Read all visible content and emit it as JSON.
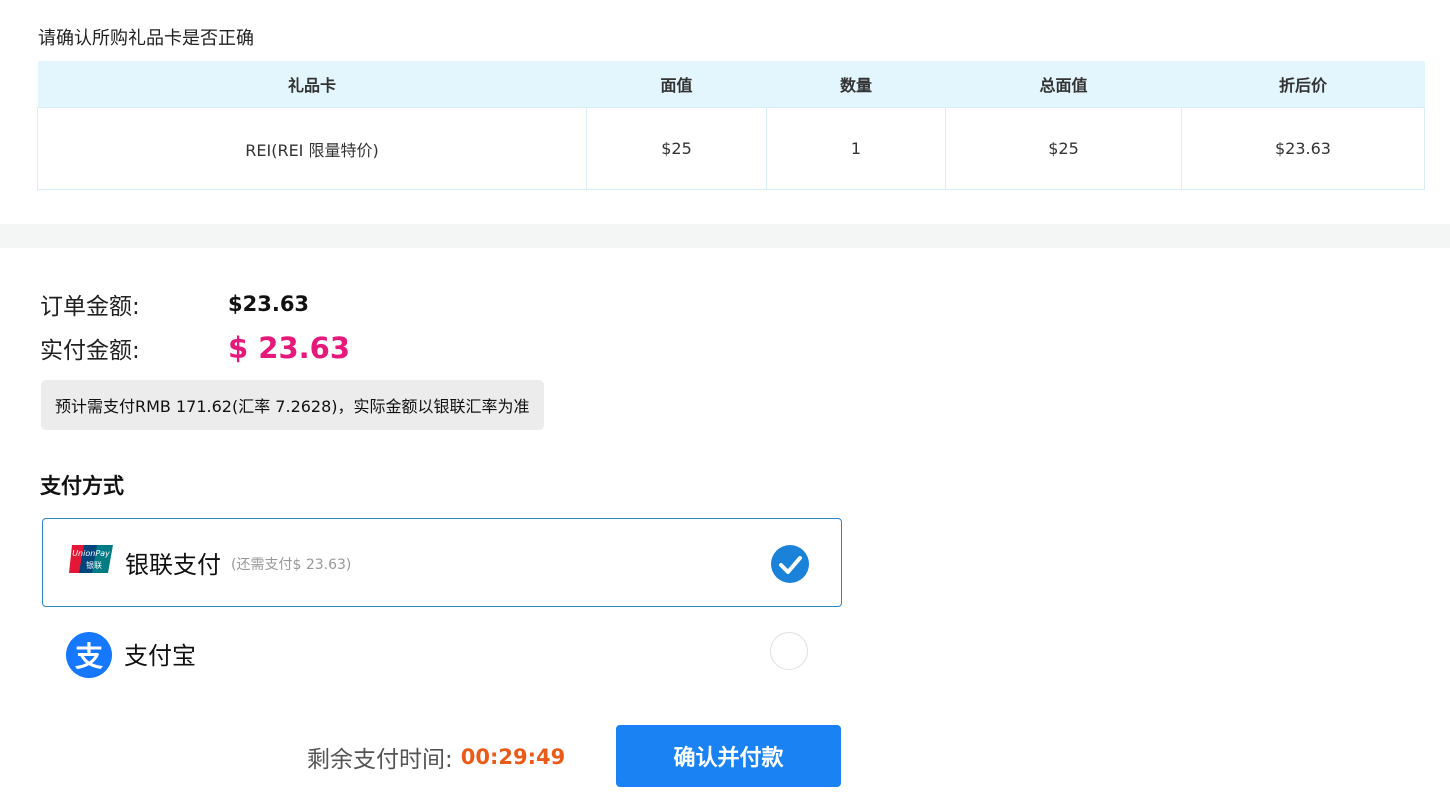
{
  "header": {
    "confirm_title": "请确认所购礼品卡是否正确"
  },
  "table": {
    "columns": [
      "礼品卡",
      "面值",
      "数量",
      "总面值",
      "折后价"
    ],
    "rows": [
      [
        "REI(REI 限量特价)",
        "$25",
        "1",
        "$25",
        "$23.63"
      ]
    ]
  },
  "amounts": {
    "order_label": "订单金额:",
    "order_value": "$23.63",
    "paid_label": "实付金额:",
    "paid_value": "$ 23.63",
    "rmb_note": "预计需支付RMB 171.62(汇率 7.2628)，实际金额以银联汇率为准"
  },
  "payment": {
    "title": "支付方式",
    "options": [
      {
        "name": "银联支付",
        "hint": "(还需支付$ 23.63)",
        "icon": "unionpay-logo-icon",
        "logo_text_top": "UnionPay",
        "logo_text_bottom": "银联",
        "selected": true
      },
      {
        "name": "支付宝",
        "icon": "alipay-logo-icon",
        "logo_glyph": "支",
        "selected": false
      }
    ]
  },
  "footer": {
    "timer_label": "剩余支付时间:",
    "timer_value": "00:29:49",
    "confirm_label": "确认并付款"
  },
  "colors": {
    "accent_blue": "#1a82f2",
    "price_pink": "#e6197a",
    "timer_orange": "#ea5b1a",
    "table_header_bg": "#e3f5fd",
    "alipay_blue": "#1677ff"
  }
}
